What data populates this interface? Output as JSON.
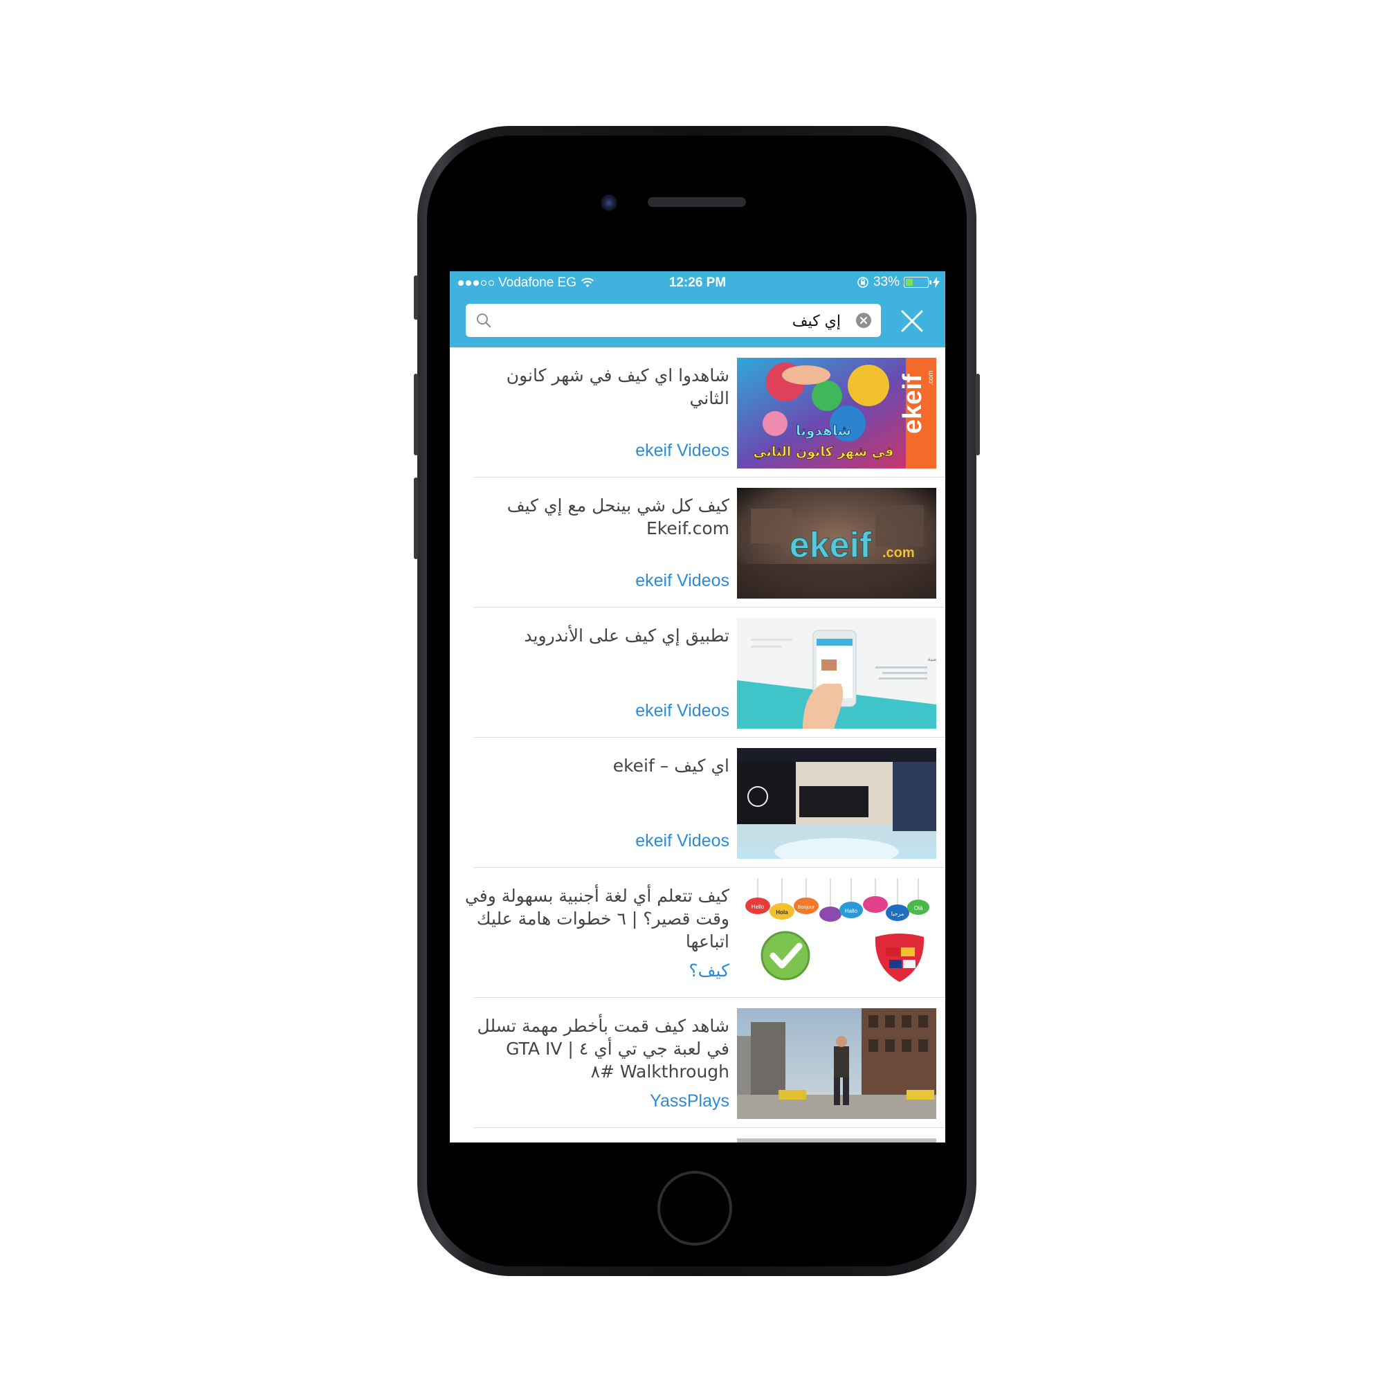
{
  "status_bar": {
    "carrier": "Vodafone EG",
    "time": "12:26 PM",
    "battery_percent": "33%",
    "battery_level": 0.33,
    "signal_bars_filled": 3,
    "signal_bars_total": 5
  },
  "search": {
    "query": "إي كيف"
  },
  "results": [
    {
      "title": "شاهدوا اي كيف في شهر كانون الثاني",
      "channel": "ekeif Videos",
      "thumb_text_top": "شاهدونا",
      "thumb_text_bottom": "في شهر كانون الثاني",
      "thumb_logo": "ekeif",
      "thumb_logo_small": ".com"
    },
    {
      "title": "كيف كل شي بينحل مع إي كيف Ekeif.com",
      "channel": "ekeif Videos",
      "thumb_logo": "ekeif",
      "thumb_logo_suffix": ".com"
    },
    {
      "title": "تطبيق إي كيف على الأندرويد",
      "channel": "ekeif Videos",
      "thumb_caption": "الصفحة الشخصية"
    },
    {
      "title": "اي كيف – ekeif",
      "channel": "ekeif Videos"
    },
    {
      "title": "كيف تتعلم أي لغة أجنبية بسهولة وفي وقت قصير؟ | ٦ خطوات هامة عليك اتباعها",
      "channel": "كيف؟",
      "thumb_bubbles": [
        "Hello",
        "Hola",
        "Bonjour",
        "Hallo",
        "مرحبا",
        "Olá"
      ]
    },
    {
      "title": "شاهد كيف قمت بأخطر مهمة تسلل في لعبة جي تي أي ٤ | GTA IV Walkthrough #٨",
      "channel": "YassPlays"
    }
  ],
  "colors": {
    "header": "#3fb3dd",
    "channel_link": "#2c8bd4",
    "title_text": "#444444",
    "divider": "#dcdcdc"
  }
}
